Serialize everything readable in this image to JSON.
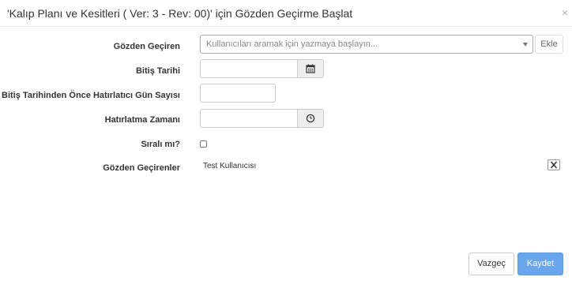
{
  "header": {
    "title": "'Kalıp Planı ve Kesitleri ( Ver: 3 - Rev: 00)' için Gözden Geçirme Başlat",
    "close_glyph": "×"
  },
  "form": {
    "reviewer_label": "Gözden Geçiren",
    "reviewer_placeholder": "Kullanıcıları aramak için yazmaya başlayın...",
    "add_button_label": "Ekle",
    "end_date_label": "Bitiş Tarihi",
    "end_date_value": "",
    "reminder_days_label": "Bitiş Tarihinden Önce Hatırlatıcı Gün Sayısı",
    "reminder_days_value": "",
    "reminder_time_label": "Hatırlatma Zamanı",
    "reminder_time_value": "",
    "sequential_label": "Sıralı mı?",
    "sequential_checked": false,
    "reviewers_label": "Gözden Geçirenler",
    "reviewers": [
      "Test Kullanıcısı"
    ]
  },
  "footer": {
    "cancel_label": "Vazgeç",
    "save_label": "Kaydet"
  },
  "icons": {
    "calendar": "calendar-icon",
    "clock": "clock-icon",
    "remove": "remove-icon",
    "caret": "caret-down-icon"
  },
  "colors": {
    "primary": "#6aa6ec",
    "addon_bg": "#eeeeee",
    "border": "#cccccc"
  }
}
